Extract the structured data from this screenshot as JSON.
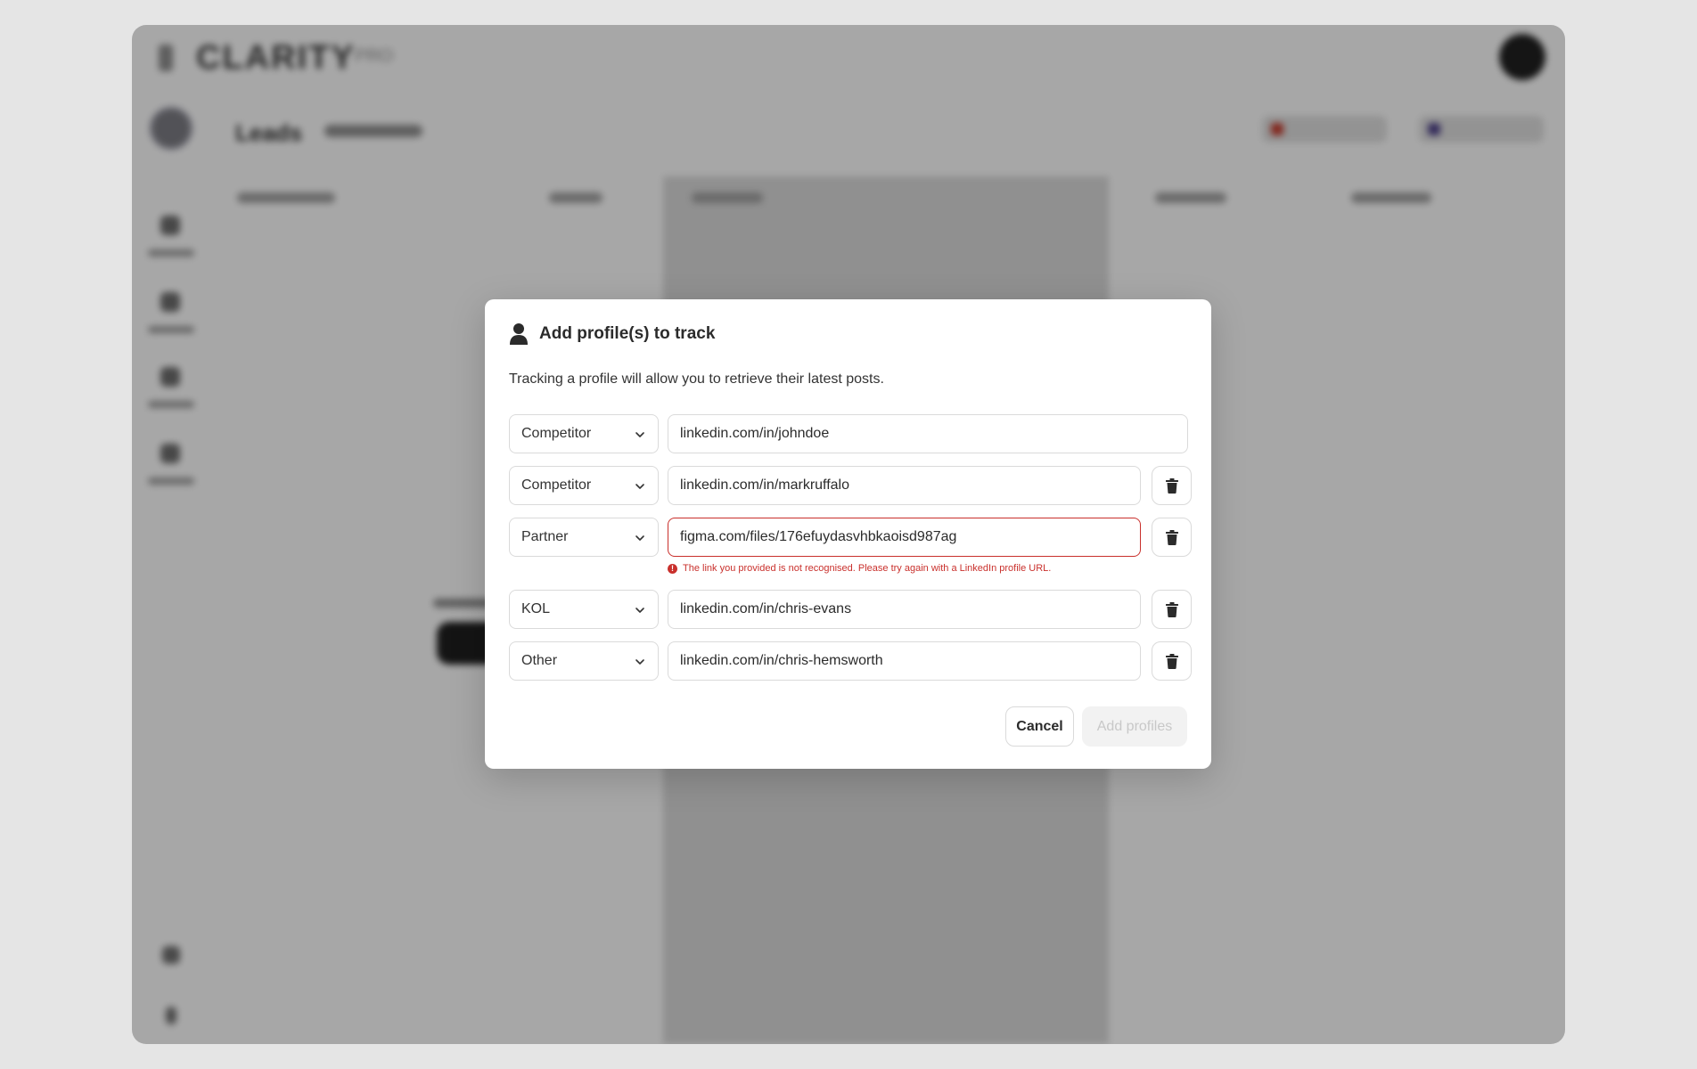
{
  "background": {
    "logo_text": "CLARITY",
    "logo_badge": "PRO",
    "page_title": "Leads"
  },
  "modal": {
    "title": "Add profile(s) to track",
    "description": "Tracking a profile will allow you to retrieve their latest posts.",
    "rows": [
      {
        "category": "Competitor",
        "url": "linkedin.com/in/johndoe",
        "deletable": false,
        "error": ""
      },
      {
        "category": "Competitor",
        "url": "linkedin.com/in/markruffalo",
        "deletable": true,
        "error": ""
      },
      {
        "category": "Partner",
        "url": "figma.com/files/176efuydasvhbkaoisd987ag",
        "deletable": true,
        "error": "The link you provided is not recognised. Please try again with a LinkedIn profile URL."
      },
      {
        "category": "KOL",
        "url": "linkedin.com/in/chris-evans",
        "deletable": true,
        "error": ""
      },
      {
        "category": "Other",
        "url": "linkedin.com/in/chris-hemsworth",
        "deletable": true,
        "error": ""
      }
    ],
    "cancel_label": "Cancel",
    "submit_label": "Add profiles"
  },
  "colors": {
    "error": "#c9302c",
    "overlay": "rgba(0,0,0,0.32)",
    "disabled_text": "#c8c8c8"
  },
  "icons": {
    "title_icon": "user-icon",
    "row_dropdown": "chevron-down-icon",
    "row_delete": "trash-icon",
    "error_indicator": "error-icon"
  }
}
